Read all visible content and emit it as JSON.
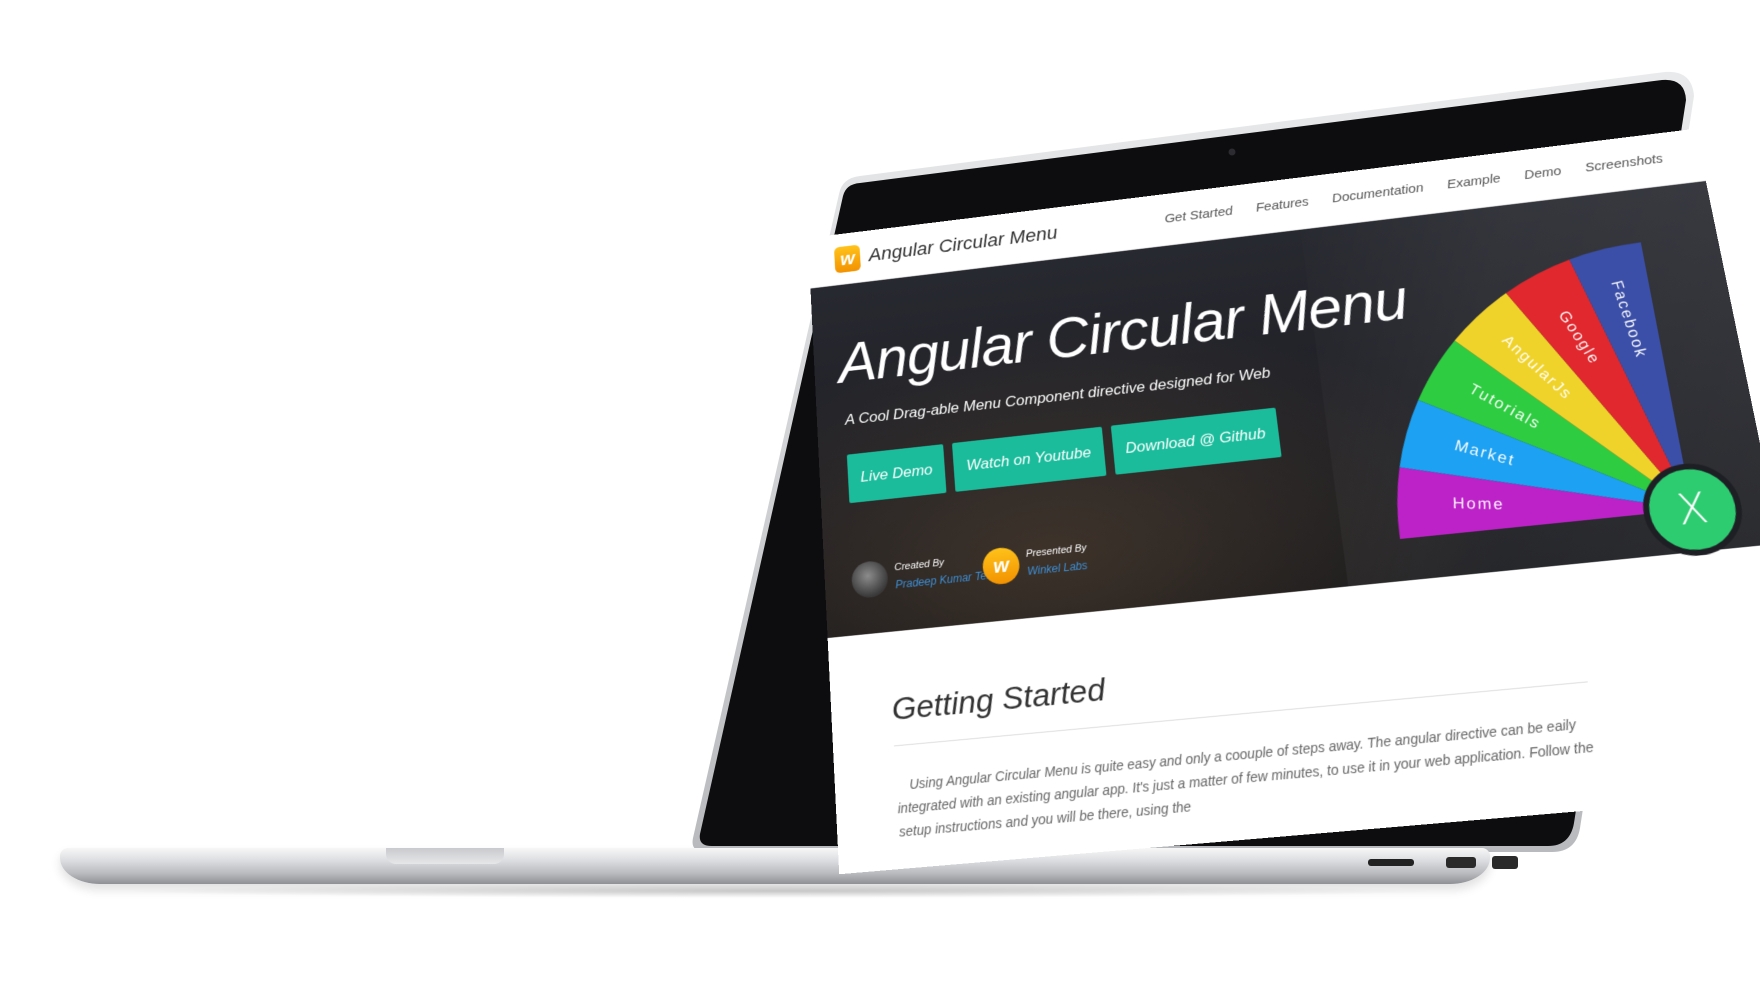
{
  "navbar": {
    "logo_letter": "w",
    "brand": "Angular Circular Menu",
    "links": [
      "Get Started",
      "Features",
      "Documentation",
      "Example",
      "Demo",
      "Screenshots"
    ]
  },
  "hero": {
    "title": "Angular Circular Menu",
    "subtitle": "A Cool Drag-able Menu Component directive designed for Web",
    "buttons": [
      "Live Demo",
      "Watch on Youtube",
      "Download @ Github"
    ],
    "created_label": "Created By",
    "created_name": "Pradeep Kumar Terli",
    "presented_label": "Presented By",
    "presented_name": "Winkel Labs",
    "presenter_logo_letter": "w"
  },
  "circular_menu": {
    "items": [
      {
        "label": "Home",
        "color": "#bd22c9"
      },
      {
        "label": "Market",
        "color": "#1da1f2"
      },
      {
        "label": "Tutorials",
        "color": "#2ecc40"
      },
      {
        "label": "AngularJs",
        "color": "#f0d32a"
      },
      {
        "label": "Google",
        "color": "#e0282e"
      },
      {
        "label": "Facebook",
        "color": "#3b4fa8"
      }
    ],
    "close_color": "#2ecc71",
    "close_glyph": "X"
  },
  "content": {
    "section_title": "Getting Started",
    "body": "Using Angular Circular Menu is quite easy and only a coouple of steps away. The angular directive can be eaily integrated with an existing angular app. It's just a matter of few minutes, to use it in your web application. Follow the setup instructions and you will be there, using the"
  }
}
